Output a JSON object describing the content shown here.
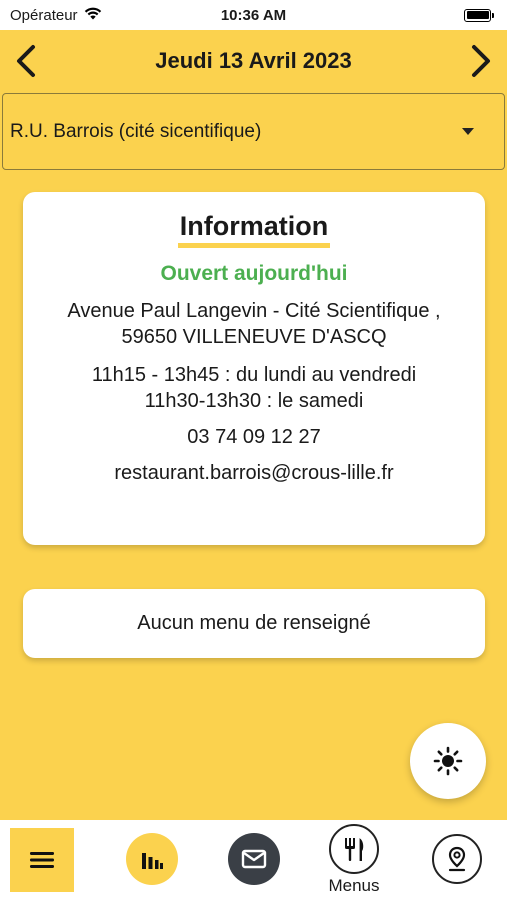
{
  "status_bar": {
    "carrier": "Opérateur",
    "time": "10:36 AM"
  },
  "header": {
    "date": "Jeudi 13 Avril 2023",
    "prev_icon": "chevron-left-icon",
    "next_icon": "chevron-right-icon"
  },
  "restaurant_select": {
    "value": "R.U. Barrois (cité sicentifique)"
  },
  "info": {
    "title": "Information",
    "status": "Ouvert aujourd'hui",
    "status_color": "#4caf50",
    "address": "Avenue Paul Langevin - Cité Scientifique , 59650 VILLENEUVE D'ASCQ",
    "hours_weekday": "11h15 - 13h45 : du lundi au vendredi",
    "hours_saturday": "11h30-13h30 : le samedi",
    "phone": "03 74 09 12 27",
    "email": "restaurant.barrois@crous-lille.fr"
  },
  "menu_status": "Aucun menu de renseigné",
  "theme_toggle_icon": "sun-icon",
  "bottom_nav": {
    "items": [
      {
        "icon": "hamburger-menu-icon"
      },
      {
        "icon": "bar-chart-icon"
      },
      {
        "icon": "mail-icon"
      },
      {
        "icon": "fork-knife-icon",
        "label": "Menus"
      },
      {
        "icon": "map-pin-icon"
      }
    ]
  },
  "colors": {
    "accent": "#FBD24E",
    "dark": "#3a3f46"
  }
}
